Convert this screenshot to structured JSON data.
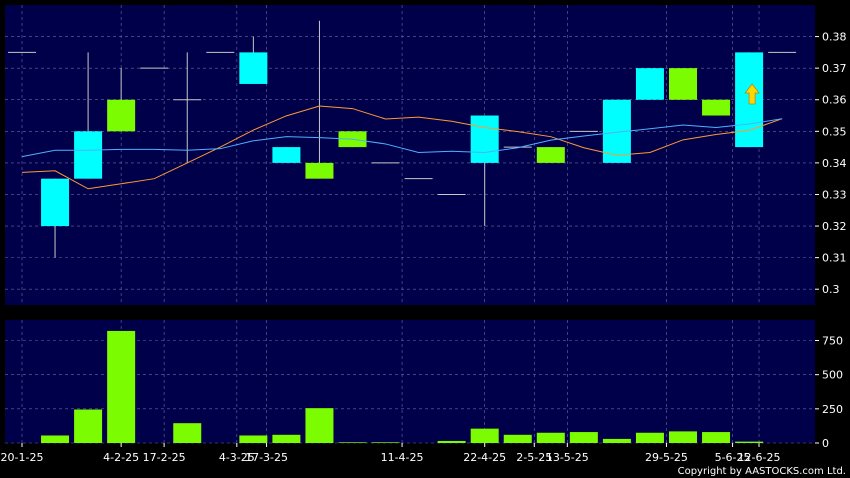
{
  "colors": {
    "background": "#000000",
    "panel": "#00004a",
    "grid": "#6a6aa0",
    "up_candle": "#00ffff",
    "down_candle": "#7cfc00",
    "volume": "#7cfc00",
    "ma_short": "#4fb0ff",
    "ma_long": "#ff9933",
    "arrow": "#ffd700",
    "text": "#ffffff"
  },
  "copyright": "Copyright by AASTOCKS.com Ltd.",
  "chart_data": [
    {
      "type": "candlestick",
      "ylim": [
        0.295,
        0.39
      ],
      "yticks": [
        "0.38",
        "0.37",
        "0.36",
        "0.35",
        "0.34",
        "0.33",
        "0.32",
        "0.31",
        "0.3"
      ],
      "grid": true,
      "candles": [
        {
          "i": 0,
          "open": 0.375,
          "close": 0.375,
          "high": 0.375,
          "low": 0.375
        },
        {
          "i": 1,
          "open": 0.32,
          "close": 0.335,
          "high": 0.335,
          "low": 0.31
        },
        {
          "i": 2,
          "open": 0.335,
          "close": 0.35,
          "high": 0.375,
          "low": 0.335
        },
        {
          "i": 3,
          "open": 0.36,
          "close": 0.35,
          "high": 0.37,
          "low": 0.35
        },
        {
          "i": 4,
          "open": 0.37,
          "close": 0.37,
          "high": 0.37,
          "low": 0.37
        },
        {
          "i": 5,
          "open": 0.36,
          "close": 0.36,
          "high": 0.375,
          "low": 0.34
        },
        {
          "i": 6,
          "open": 0.375,
          "close": 0.375,
          "high": 0.375,
          "low": 0.375
        },
        {
          "i": 7,
          "open": 0.365,
          "close": 0.375,
          "high": 0.38,
          "low": 0.365
        },
        {
          "i": 8,
          "open": 0.34,
          "close": 0.345,
          "high": 0.345,
          "low": 0.34
        },
        {
          "i": 9,
          "open": 0.34,
          "close": 0.335,
          "high": 0.385,
          "low": 0.335
        },
        {
          "i": 10,
          "open": 0.35,
          "close": 0.345,
          "high": 0.35,
          "low": 0.345
        },
        {
          "i": 11,
          "open": 0.34,
          "close": 0.34,
          "high": 0.34,
          "low": 0.34
        },
        {
          "i": 12,
          "open": 0.335,
          "close": 0.335,
          "high": 0.335,
          "low": 0.335
        },
        {
          "i": 13,
          "open": 0.33,
          "close": 0.33,
          "high": 0.33,
          "low": 0.33
        },
        {
          "i": 14,
          "open": 0.34,
          "close": 0.355,
          "high": 0.355,
          "low": 0.32
        },
        {
          "i": 15,
          "open": 0.345,
          "close": 0.345,
          "high": 0.345,
          "low": 0.345
        },
        {
          "i": 16,
          "open": 0.345,
          "close": 0.34,
          "high": 0.345,
          "low": 0.34
        },
        {
          "i": 17,
          "open": 0.35,
          "close": 0.35,
          "high": 0.35,
          "low": 0.35
        },
        {
          "i": 18,
          "open": 0.34,
          "close": 0.36,
          "high": 0.36,
          "low": 0.34
        },
        {
          "i": 19,
          "open": 0.36,
          "close": 0.37,
          "high": 0.37,
          "low": 0.36
        },
        {
          "i": 20,
          "open": 0.37,
          "close": 0.36,
          "high": 0.37,
          "low": 0.36
        },
        {
          "i": 21,
          "open": 0.36,
          "close": 0.355,
          "high": 0.36,
          "low": 0.355
        },
        {
          "i": 22,
          "open": 0.345,
          "close": 0.375,
          "high": 0.375,
          "low": 0.345
        },
        {
          "i": 23,
          "open": 0.375,
          "close": 0.375,
          "high": 0.375,
          "low": 0.375
        }
      ],
      "ma_short": [
        0.342,
        0.344,
        0.344,
        0.3443,
        0.3443,
        0.344,
        0.3445,
        0.347,
        0.3483,
        0.348,
        0.3475,
        0.346,
        0.3433,
        0.3437,
        0.3433,
        0.3448,
        0.3472,
        0.3485,
        0.3497,
        0.3508,
        0.352,
        0.3512,
        0.3523,
        0.354
      ],
      "ma_long": [
        0.337,
        0.3375,
        0.3318,
        0.3334,
        0.335,
        0.34,
        0.345,
        0.3504,
        0.3549,
        0.358,
        0.3572,
        0.3539,
        0.3545,
        0.3532,
        0.3512,
        0.3499,
        0.3483,
        0.3448,
        0.3424,
        0.3433,
        0.3473,
        0.349,
        0.3503,
        0.354
      ],
      "last_arrow_value": 0.3615
    },
    {
      "type": "bar",
      "series": "volume",
      "ylim": [
        0,
        900
      ],
      "yticks": [
        "750",
        "500",
        "250",
        "0"
      ],
      "values": [
        0,
        55,
        245,
        820,
        0,
        145,
        0,
        55,
        60,
        255,
        5,
        5,
        0,
        15,
        105,
        60,
        75,
        80,
        30,
        75,
        85,
        80,
        10,
        0
      ],
      "xticks": [
        {
          "i": 0,
          "label": "20-1-25"
        },
        {
          "i": 3,
          "label": "4-2-25"
        },
        {
          "i": 4.3,
          "label": "17-2-25"
        },
        {
          "i": 6.5,
          "label": "4-3-25"
        },
        {
          "i": 7.4,
          "label": "17-3-25"
        },
        {
          "i": 11.5,
          "label": "11-4-25"
        },
        {
          "i": 14,
          "label": "22-4-25"
        },
        {
          "i": 15.5,
          "label": "2-5-25"
        },
        {
          "i": 16.5,
          "label": "13-5-25"
        },
        {
          "i": 19.5,
          "label": "29-5-25"
        },
        {
          "i": 21.5,
          "label": "5-6-25"
        },
        {
          "i": 22.3,
          "label": "12-6-25"
        }
      ]
    }
  ]
}
